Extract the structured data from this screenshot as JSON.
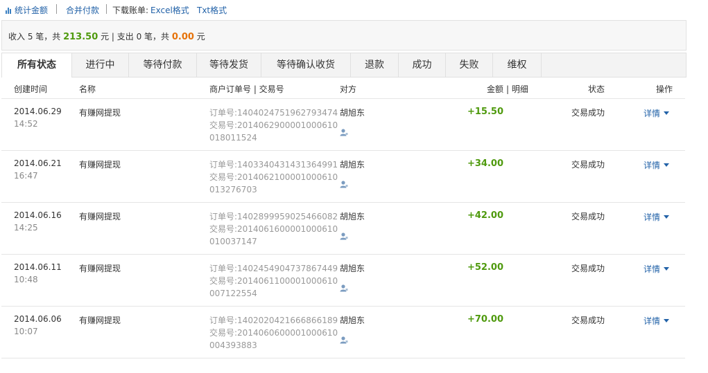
{
  "toolbar": {
    "stats_label": "统计金额",
    "merge_pay_label": "合并付款",
    "download_label": "下载账单:",
    "excel_label": "Excel格式",
    "txt_label": "Txt格式"
  },
  "summary": {
    "income_prefix": "收入 5 笔，共",
    "income_amount": "213.50",
    "income_unit": "元 | 支出 0 笔，共",
    "expense_amount": "0.00",
    "expense_unit": "元"
  },
  "tabs": [
    "所有状态",
    "进行中",
    "等待付款",
    "等待发货",
    "等待确认收货",
    "退款",
    "成功",
    "失败",
    "维权"
  ],
  "columns": {
    "created": "创建时间",
    "name": "名称",
    "order_no": "商户订单号 | 交易号",
    "party": "对方",
    "amount": "金额",
    "detail": "| 明细",
    "status": "状态",
    "action": "操作"
  },
  "rows": [
    {
      "date": "2014.06.29",
      "time": "14:52",
      "name": "有赚网提现",
      "order": "订单号:1404024751962793474",
      "trade1": "交易号:2014062900001000610",
      "trade2": "018011524",
      "party": "胡旭东",
      "amount": "+15.50",
      "status": "交易成功",
      "action": "详情"
    },
    {
      "date": "2014.06.21",
      "time": "16:47",
      "name": "有赚网提现",
      "order": "订单号:1403340431431364991",
      "trade1": "交易号:2014062100001000610",
      "trade2": "013276703",
      "party": "胡旭东",
      "amount": "+34.00",
      "status": "交易成功",
      "action": "详情"
    },
    {
      "date": "2014.06.16",
      "time": "14:25",
      "name": "有赚网提现",
      "order": "订单号:1402899959025466082",
      "trade1": "交易号:2014061600001000610",
      "trade2": "010037147",
      "party": "胡旭东",
      "amount": "+42.00",
      "status": "交易成功",
      "action": "详情"
    },
    {
      "date": "2014.06.11",
      "time": "10:48",
      "name": "有赚网提现",
      "order": "订单号:1402454904737867449",
      "trade1": "交易号:2014061100001000610",
      "trade2": "007122554",
      "party": "胡旭东",
      "amount": "+52.00",
      "status": "交易成功",
      "action": "详情"
    },
    {
      "date": "2014.06.06",
      "time": "10:07",
      "name": "有赚网提现",
      "order": "订单号:1402020421666866189",
      "trade1": "交易号:2014060600001000610",
      "trade2": "004393883",
      "party": "胡旭东",
      "amount": "+70.00",
      "status": "交易成功",
      "action": "详情"
    }
  ]
}
